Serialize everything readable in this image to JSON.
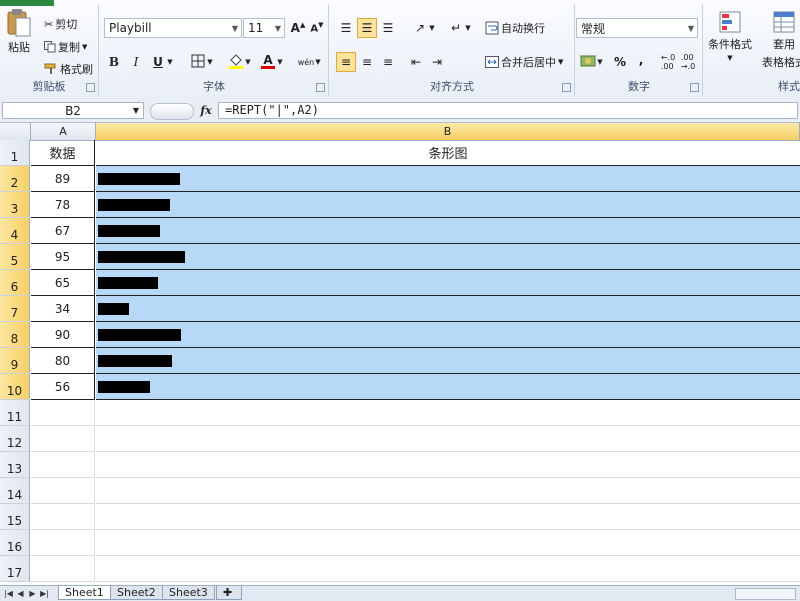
{
  "ribbon": {
    "clipboard": {
      "paste": "粘贴",
      "cut": "剪切",
      "copy": "复制",
      "format_painter": "格式刷",
      "label": "剪贴板"
    },
    "font": {
      "name": "Playbill",
      "size": "11",
      "label": "字体",
      "bold": "B",
      "italic": "I",
      "underline": "U",
      "phonetic": "wén"
    },
    "alignment": {
      "wrap_text": "自动换行",
      "merge_center": "合并后居中",
      "label": "对齐方式"
    },
    "number": {
      "format": "常规",
      "percent": "%",
      "comma": ",",
      "label": "数字"
    },
    "styles": {
      "conditional_format": "条件格式",
      "table_format_1": "套用",
      "table_format_2": "表格格式",
      "label": "样式"
    }
  },
  "formula_bar": {
    "name_box": "B2",
    "fx": "fx",
    "formula": "=REPT(\"|\",A2)"
  },
  "sheet": {
    "columns": [
      "A",
      "B"
    ],
    "header_row": {
      "row": "1",
      "a": "数据",
      "b": "条形图"
    },
    "rows": [
      {
        "row": "2",
        "value": "89"
      },
      {
        "row": "3",
        "value": "78"
      },
      {
        "row": "4",
        "value": "67"
      },
      {
        "row": "5",
        "value": "95"
      },
      {
        "row": "6",
        "value": "65"
      },
      {
        "row": "7",
        "value": "34"
      },
      {
        "row": "8",
        "value": "90"
      },
      {
        "row": "9",
        "value": "80"
      },
      {
        "row": "10",
        "value": "56"
      }
    ],
    "empty_rows": [
      "11",
      "12",
      "13",
      "14",
      "15",
      "16",
      "17"
    ]
  },
  "tabs": [
    "Sheet1",
    "Sheet2",
    "Sheet3"
  ],
  "colors": {
    "selection": "#b8d8f8",
    "header_selected": "#f6cf62",
    "bar": "#000000"
  }
}
